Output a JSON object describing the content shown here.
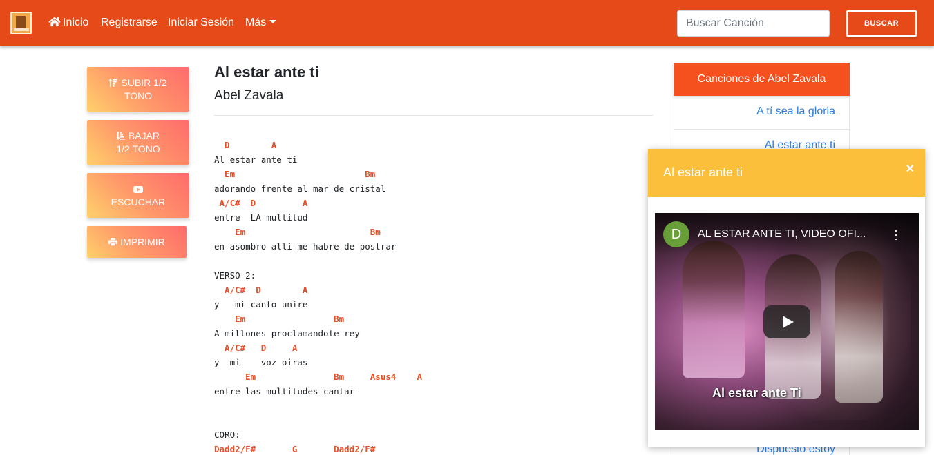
{
  "navbar": {
    "logo": "site-logo",
    "home_label": "Inicio",
    "register_label": "Registrarse",
    "login_label": "Iniciar Sesión",
    "more_label": "Más",
    "search_placeholder": "Buscar Canción",
    "search_button": "BUSCAR",
    "color": "#e64a19"
  },
  "actions": {
    "up": {
      "line1": "SUBIR 1/2",
      "line2": "TONO",
      "icon": "sort-amount-up-icon"
    },
    "down": {
      "line1": "BAJAR",
      "line2": "1/2 TONO",
      "icon": "sort-amount-down-icon"
    },
    "listen": {
      "line1": "ESCUCHAR",
      "icon": "youtube-icon"
    },
    "print": {
      "label": "IMPRIMIR",
      "icon": "print-icon"
    }
  },
  "song": {
    "title": "Al estar ante ti",
    "artist": "Abel Zavala",
    "lines": [
      {
        "type": "chord",
        "text": "  D        A"
      },
      {
        "type": "text",
        "text": "Al estar ante ti"
      },
      {
        "type": "chord",
        "text": "  Em                         Bm"
      },
      {
        "type": "text",
        "text": "adorando frente al mar de cristal"
      },
      {
        "type": "chord",
        "text": " A/C#  D         A"
      },
      {
        "type": "text",
        "text": "entre  LA multitud"
      },
      {
        "type": "chord",
        "text": "    Em                        Bm"
      },
      {
        "type": "text",
        "text": "en asombro alli me habre de postrar"
      },
      {
        "type": "text",
        "text": ""
      },
      {
        "type": "text",
        "text": "VERSO 2:"
      },
      {
        "type": "chord",
        "text": "  A/C#  D        A"
      },
      {
        "type": "text",
        "text": "y   mi canto unire"
      },
      {
        "type": "chord",
        "text": "    Em                 Bm"
      },
      {
        "type": "text",
        "text": "A millones proclamandote rey"
      },
      {
        "type": "chord",
        "text": "  A/C#   D     A"
      },
      {
        "type": "text",
        "text": "y  mi    voz oiras"
      },
      {
        "type": "chord",
        "text": "      Em               Bm     Asus4    A"
      },
      {
        "type": "text",
        "text": "entre las multitudes cantar"
      },
      {
        "type": "text",
        "text": ""
      },
      {
        "type": "text",
        "text": ""
      },
      {
        "type": "text",
        "text": "CORO:"
      },
      {
        "type": "chord",
        "text": "Dadd2/F#       G       Dadd2/F#"
      }
    ]
  },
  "sidebar": {
    "header": "Canciones de Abel Zavala",
    "songs": [
      "A tí sea la gloria",
      "Al estar ante ti",
      "Dispuesto estoy"
    ]
  },
  "popup": {
    "title": "Al estar ante ti",
    "close": "×",
    "video": {
      "channel_initial": "D",
      "title": "AL ESTAR ANTE TI, VIDEO OFI...",
      "caption": "Al estar ante Ti"
    }
  }
}
